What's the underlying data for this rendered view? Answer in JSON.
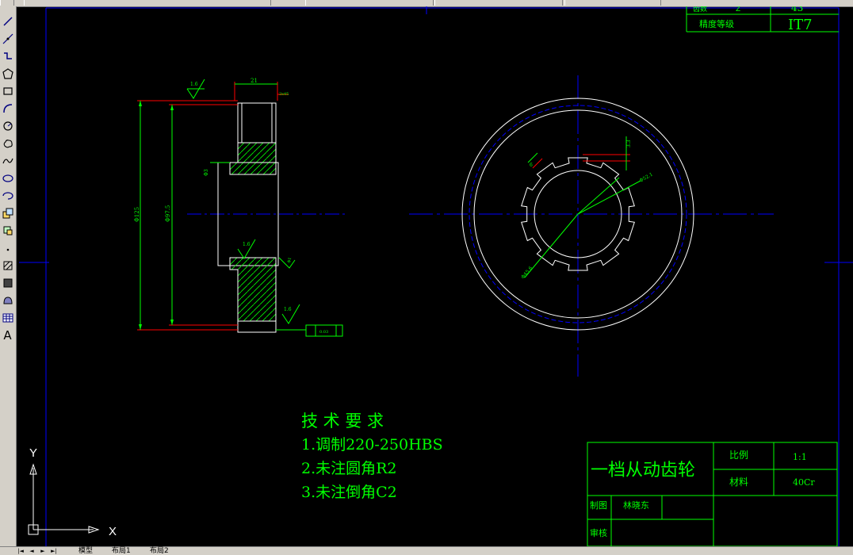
{
  "toolbar": {
    "tools": [
      {
        "name": "line-tool-icon"
      },
      {
        "name": "construction-line-tool-icon"
      },
      {
        "name": "polyline-tool-icon"
      },
      {
        "name": "polygon-tool-icon"
      },
      {
        "name": "rectangle-tool-icon"
      },
      {
        "name": "arc-tool-icon"
      },
      {
        "name": "circle-tool-icon"
      },
      {
        "name": "revision-cloud-tool-icon"
      },
      {
        "name": "spline-tool-icon"
      },
      {
        "name": "ellipse-tool-icon"
      },
      {
        "name": "ellipse-arc-tool-icon"
      },
      {
        "name": "insert-block-tool-icon"
      },
      {
        "name": "make-block-tool-icon"
      },
      {
        "name": "point-tool-icon"
      },
      {
        "name": "hatch-tool-icon"
      },
      {
        "name": "gradient-tool-icon"
      },
      {
        "name": "region-tool-icon"
      },
      {
        "name": "table-tool-icon"
      }
    ],
    "text_tool_label": "A"
  },
  "drawing": {
    "tech_requirements": {
      "heading": "技 术 要 求",
      "items": [
        "1.调制220-250HBS",
        "2.未注圆角R2",
        "3.未注倒角C2"
      ]
    },
    "title_block": {
      "part_name": "一档从动齿轮",
      "scale_label": "比例",
      "scale_value": "1:1",
      "material_label": "材料",
      "material_value": "40Cr",
      "drawn_label": "制图",
      "drawn_by": "林晓东",
      "review_label": "审核"
    },
    "param_table": {
      "top_partial_left": "齿数",
      "top_partial_mid": "Z",
      "top_partial_value": "43",
      "precision_label": "精度等级",
      "precision_value": "IT7"
    },
    "dimensions": {
      "width": "21",
      "chamfer": "2x45",
      "outer_dia": "Φ125",
      "root_dia": "Φ97.5",
      "hub_step": "Φ3",
      "rough1": "1.6",
      "rough2": "1.6",
      "rough3": "1.6",
      "flatness": "Φ1",
      "tolerance_frame": "0.03",
      "spline_width": "6",
      "spline_height": "3.3",
      "spline_outer": "Φ52.1",
      "spline_inner": "Φ45.6"
    },
    "ucs": {
      "y_label": "Y",
      "x_label": "X"
    }
  },
  "layout_tabs": {
    "nav": [
      "|◄",
      "◄",
      "►",
      "►|"
    ],
    "tabs": [
      "模型",
      "布局1",
      "布局2"
    ]
  },
  "colors": {
    "background": "#000000",
    "green": "#00ff00",
    "red": "#ff0000",
    "blue": "#0000ff",
    "white": "#ffffff"
  }
}
